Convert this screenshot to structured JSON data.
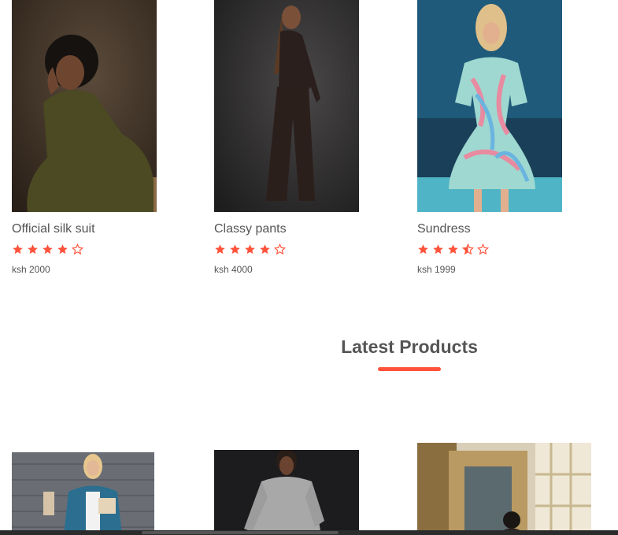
{
  "featured": [
    {
      "name": "Official silk suit",
      "rating": 4,
      "price": "ksh 2000",
      "image": "woman-olive-jumpsuit"
    },
    {
      "name": "Classy pants",
      "rating": 4,
      "price": "ksh 4000",
      "image": "woman-black-pants"
    },
    {
      "name": "Sundress",
      "rating": 3.5,
      "price": "ksh 1999",
      "image": "woman-floral-sundress"
    }
  ],
  "latest_section": {
    "title": "Latest Products",
    "accent_color": "#ff523b"
  },
  "latest": [
    {
      "image": "woman-blue-blazer"
    },
    {
      "image": "woman-grey-dress"
    },
    {
      "image": "woman-ornate-interior"
    }
  ],
  "colors": {
    "star": "#ff523b",
    "text": "#555555"
  }
}
